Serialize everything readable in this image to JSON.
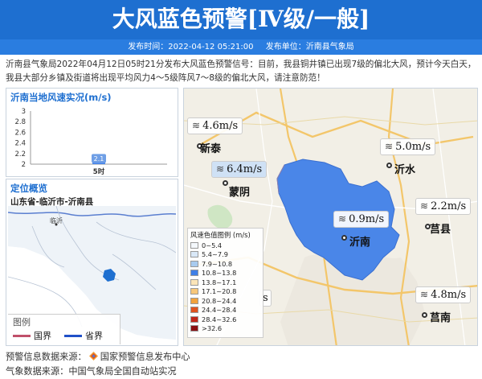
{
  "header": {
    "title": "大风蓝色预警[Ⅳ级/一般]",
    "publish_time": "发布时间：2022-04-12 05:21:00",
    "publisher": "发布单位：沂南县气象局"
  },
  "notice": "沂南县气象局2022年04月12日05时21分发布大风蓝色预警信号：目前，我县铜井镇已出现7级的偏北大风，预计今天白天，我县大部分乡镇及街道将出现平均风力4～5级阵风7～8级的偏北大风，请注意防范！",
  "wind_panel": {
    "title": "沂南当地风速实况(m/s)",
    "chart_data": {
      "type": "bar",
      "categories": [
        "5时"
      ],
      "values": [
        2.1
      ],
      "data_labels": [
        "2.1"
      ],
      "yticks": [
        "3",
        "2.8",
        "2.6",
        "2.4",
        "2.2",
        "2"
      ],
      "ylim": [
        2,
        3
      ]
    }
  },
  "location_panel": {
    "title": "定位概览",
    "subtitle": "山东省-临沂市-沂南县",
    "map_label": "临沂",
    "legend_title": "图例",
    "legend_items": [
      {
        "label": "国界",
        "color": "#c0506a"
      },
      {
        "label": "省界",
        "color": "#2050c8"
      }
    ]
  },
  "main_map": {
    "stations": [
      {
        "name": "新泰",
        "speed": "4.6m/s",
        "highlight": false
      },
      {
        "name": "蒙阴",
        "speed": "6.4m/s",
        "highlight": true
      },
      {
        "name": "沂水",
        "speed": "5.0m/s",
        "highlight": false
      },
      {
        "name": "莒县",
        "speed": "2.2m/s",
        "highlight": false
      },
      {
        "name": "沂南",
        "speed": "0.9m/s",
        "highlight": false
      },
      {
        "name": "莒南",
        "speed": "4.8m/s",
        "highlight": false
      }
    ],
    "partial_label": "s",
    "legend_title": "风速色值图例 (m/s)",
    "legend": [
      {
        "range": "0~5.4",
        "color": "#f4f8fc"
      },
      {
        "range": "5.4~7.9",
        "color": "#d9e8f7"
      },
      {
        "range": "7.9~10.8",
        "color": "#a8cbef"
      },
      {
        "range": "10.8~13.8",
        "color": "#3f7fe6"
      },
      {
        "range": "13.8~17.1",
        "color": "#fbe5b8"
      },
      {
        "range": "17.1~20.8",
        "color": "#f7c77a"
      },
      {
        "range": "20.8~24.4",
        "color": "#f2a23c"
      },
      {
        "range": "24.4~28.4",
        "color": "#e0531f"
      },
      {
        "range": "28.4~32.6",
        "color": "#c0271a"
      },
      {
        "range": ">32.6",
        "color": "#8a0f12"
      }
    ]
  },
  "footer": {
    "warning_source": "预警信息数据来源：",
    "warning_source_org": "国家预警信息发布中心",
    "weather_source": "气象数据来源：中国气象局全国自动站实况"
  },
  "colors": {
    "banner": "#1e6fd0",
    "county_fill": "#4a86e8",
    "accent": "#1e6fd0"
  },
  "icons": {
    "wind": "wind-icon",
    "logo": "warning-center-logo-icon"
  }
}
